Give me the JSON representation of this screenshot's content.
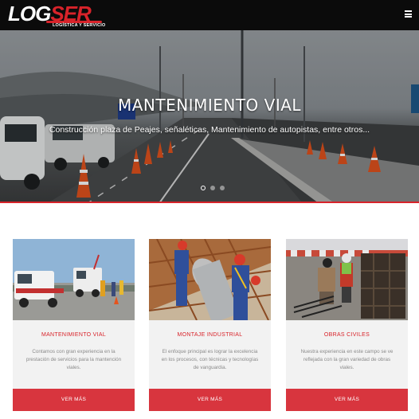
{
  "header": {
    "logo_main_a": "LOG",
    "logo_main_b": "SER",
    "logo_tagline": "LOGÍSTICA Y SERVICIO",
    "menu_icon": "hamburger-icon"
  },
  "hero": {
    "title": "MANTENIMIENTO VIAL",
    "subtitle": "Construcción plaza de Peajes, señaléticas, Mantenimiento de autopistas, entre otros...",
    "slides_total": 3,
    "active_slide": 1
  },
  "cards": [
    {
      "title": "MANTENIMIENTO VIAL",
      "description": "Contamos con gran experiencia en la prestación de servicios para la mantención viales.",
      "button": "VER MÁS"
    },
    {
      "title": "MONTAJE INDUSTRIAL",
      "description": "El enfoque principal es lograr la excelencia en los procesos, con técnicas y tecnologías de vanguardia.",
      "button": "VER MÁS"
    },
    {
      "title": "OBRAS CIVILES",
      "description": "Nuestra experiencia en este campo se ve reflejada con la gran variedad de obras viales.",
      "button": "VER MÁS"
    }
  ],
  "colors": {
    "accent": "#d8232a",
    "header_bg": "#0b0b0b",
    "card_bg": "#f2f2f2"
  }
}
